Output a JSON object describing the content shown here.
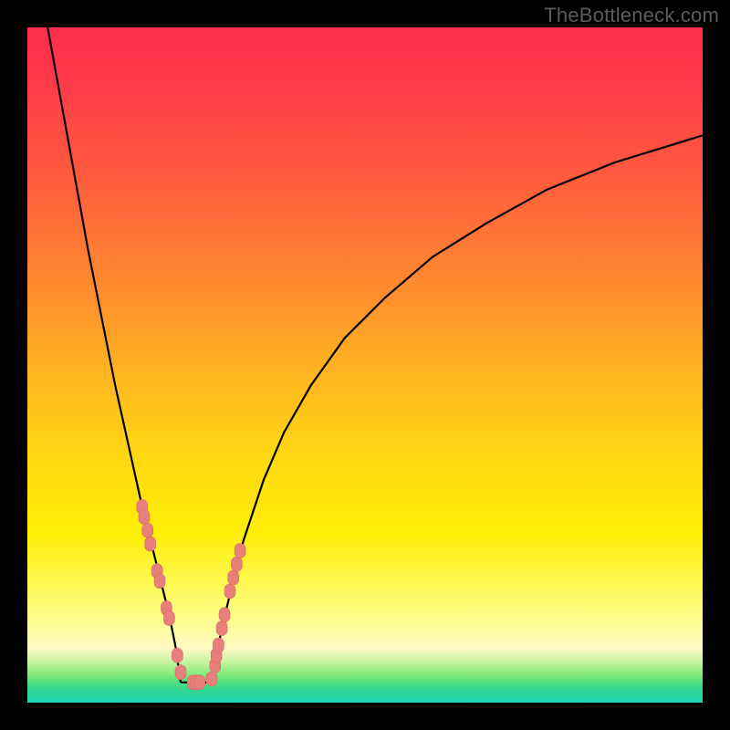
{
  "watermark": {
    "text": "TheBottleneck.com"
  },
  "colors": {
    "background": "#000000",
    "curve": "#000000",
    "datapoint_fill": "#e77f7a",
    "datapoint_stroke": "#d86b66",
    "gradient_top": "#ff2e4a",
    "gradient_mid": "#ffee08",
    "gradient_bottom": "#20d2b8"
  },
  "chart_data": {
    "type": "line",
    "title": "",
    "xlabel": "",
    "ylabel": "",
    "xlim": [
      0,
      100
    ],
    "ylim": [
      0,
      100
    ],
    "grid": false,
    "legend_position": "none",
    "series": [
      {
        "name": "bottleneck-curve-left",
        "x": [
          3,
          5,
          7,
          9,
          11,
          13,
          15,
          17,
          18,
          19,
          20,
          21,
          22,
          22.7
        ],
        "values": [
          100,
          89,
          78,
          67,
          57,
          47,
          38,
          29,
          25,
          21,
          17,
          13,
          8,
          3
        ]
      },
      {
        "name": "bottleneck-curve-right",
        "x": [
          27.3,
          28,
          29,
          30,
          32,
          35,
          38,
          42,
          47,
          53,
          60,
          68,
          77,
          87,
          100
        ],
        "values": [
          3,
          7,
          12,
          16,
          24,
          33,
          40,
          47,
          54,
          60,
          66,
          71,
          76,
          80,
          84
        ]
      },
      {
        "name": "bottleneck-curve-floor",
        "x": [
          22.7,
          25,
          27.3
        ],
        "values": [
          3,
          3,
          3
        ]
      }
    ],
    "datapoints": {
      "x": [
        17.0,
        17.3,
        17.8,
        18.2,
        19.2,
        19.6,
        20.6,
        21.0,
        22.2,
        22.7,
        24.5,
        25.0,
        25.5,
        27.3,
        27.8,
        28.0,
        28.3,
        28.8,
        29.2,
        30.0,
        30.5,
        31.0,
        31.5
      ],
      "y": [
        29.0,
        27.5,
        25.5,
        23.5,
        19.5,
        18.0,
        14.0,
        12.5,
        7.0,
        4.5,
        3.0,
        3.0,
        3.0,
        3.5,
        5.5,
        7.0,
        8.5,
        11.0,
        13.0,
        16.5,
        18.5,
        20.5,
        22.5
      ]
    },
    "minimum_x": 25,
    "annotations": []
  }
}
